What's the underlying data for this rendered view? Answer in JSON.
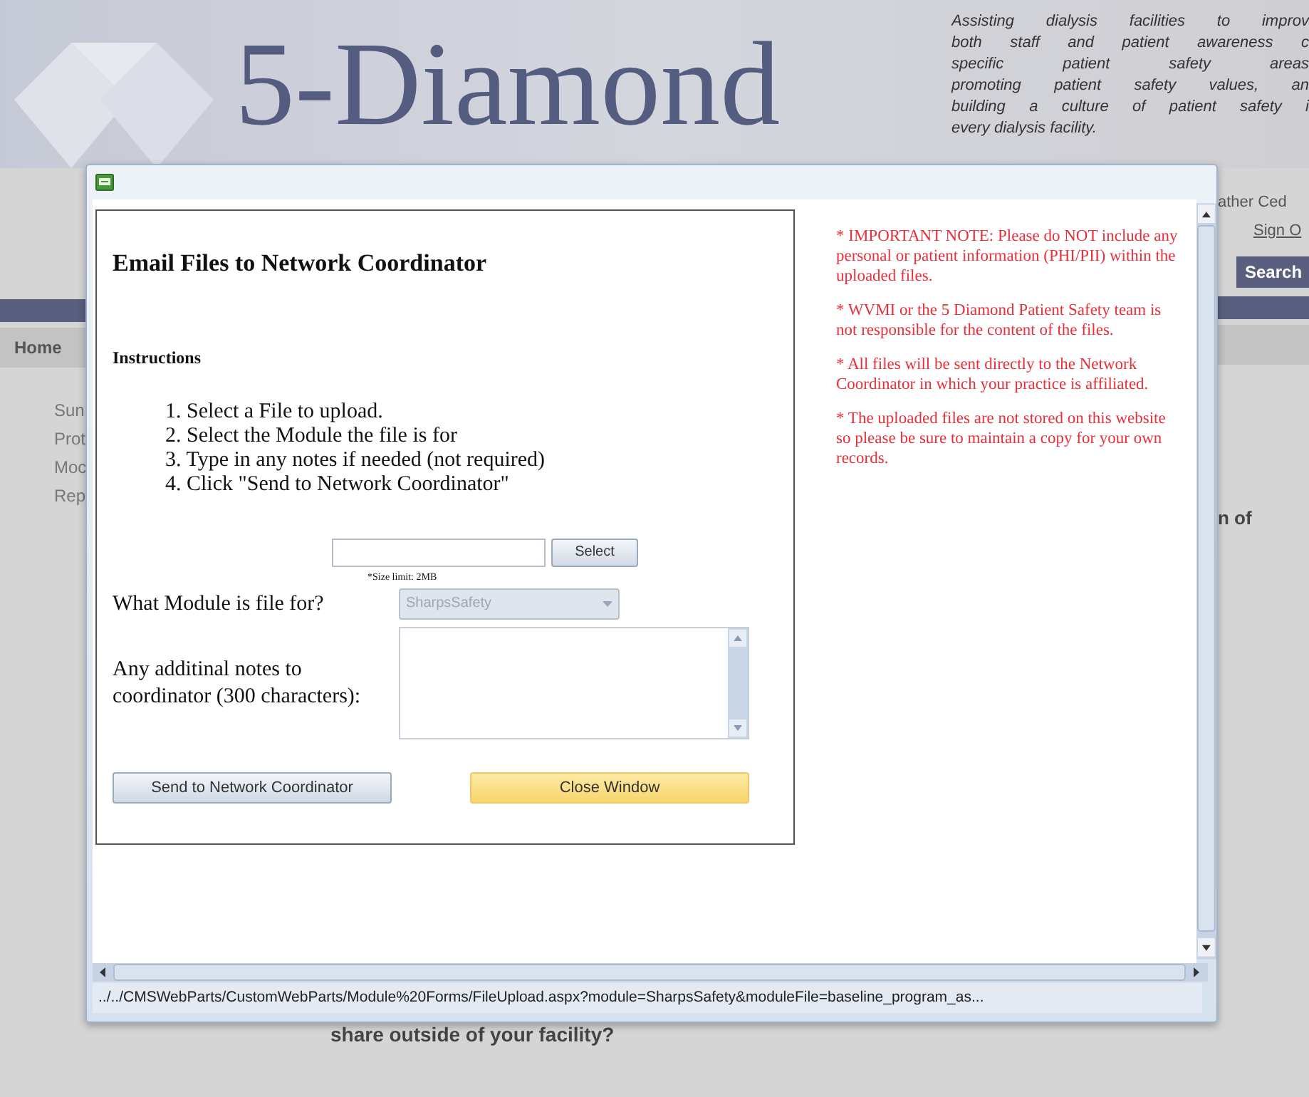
{
  "page": {
    "logo_text": "5-Diamond",
    "tagline": [
      "Assisting dialysis facilities to improv",
      "both staff and patient awareness c",
      "specific patient safety areas",
      "promoting patient safety values, an",
      "building a culture of patient safety i",
      "every dialysis facility."
    ],
    "user_fragment": "ather Ced",
    "sign_out": "Sign O",
    "search_button": "Search",
    "nav_home": "Home",
    "side_links": [
      "Sun",
      "Prot",
      "Moc",
      "Rep"
    ],
    "heading_fragment": "n of",
    "question": "share outside of your facility?"
  },
  "dialog": {
    "heading": "Email Files to Network Coordinator",
    "instructions_label": "Instructions",
    "steps": [
      "1. Select a File to upload.",
      "2. Select the Module the file is for",
      "3. Type in any notes if needed (not required)",
      "4. Click \"Send to Network Coordinator\""
    ],
    "select_button": "Select",
    "size_limit": "*Size limit: 2MB",
    "module_label": "What Module is file for?",
    "module_select": {
      "value": "SharpsSafety",
      "disabled": true
    },
    "notes_label": "Any additinal notes to coordinator (300 characters):",
    "send_button": {
      "label": "Send to Network Coordinator",
      "highlighted": false
    },
    "close_button": {
      "label": "Close Window",
      "highlighted": true
    },
    "notes": [
      "* IMPORTANT NOTE: Please do NOT include any personal or patient information (PHI/PII) within the uploaded files.",
      "* WVMI or the 5 Diamond Patient Safety team is not responsible for the content of the files.",
      "* All files will be sent directly to the Network Coordinator in which your practice is affiliated.",
      "* The uploaded files are not stored on this website so please be sure to maintain a copy for your own records."
    ],
    "status_url": "../../CMSWebParts/CustomWebParts/Module%20Forms/FileUpload.aspx?module=SharpsSafety&moduleFile=baseline_program_as..."
  }
}
